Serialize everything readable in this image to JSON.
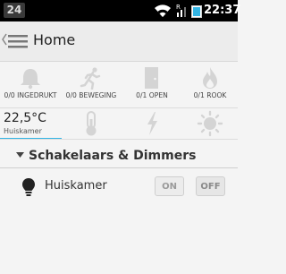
{
  "status_bar": {
    "notification_count": "24",
    "time": "22:37",
    "wifi_icon": "wifi-icon",
    "signal_icon": "signal-bars-icon",
    "battery_icon": "battery-icon"
  },
  "action_bar": {
    "title": "Home",
    "menu_icon": "hamburger-menu-icon"
  },
  "sensors": [
    {
      "icon": "bell-icon",
      "label": "0/0 INGEDRUKT"
    },
    {
      "icon": "running-person-icon",
      "label": "0/0 BEWEGING"
    },
    {
      "icon": "door-icon",
      "label": "0/1 OPEN"
    },
    {
      "icon": "flame-icon",
      "label": "0/1 ROOK"
    }
  ],
  "climate": {
    "temperature": "22,5°C",
    "room": "Huiskamer",
    "icons": [
      "thermometer-icon",
      "lightning-icon",
      "sun-icon"
    ]
  },
  "section": {
    "title": "Schakelaars & Dimmers"
  },
  "switches": [
    {
      "name": "Huiskamer",
      "on_label": "ON",
      "off_label": "OFF",
      "icon": "light-bulb-icon"
    }
  ],
  "colors": {
    "accent": "#33b5e5",
    "status_bar": "#000000",
    "icon_gray": "#d4d4d4"
  }
}
